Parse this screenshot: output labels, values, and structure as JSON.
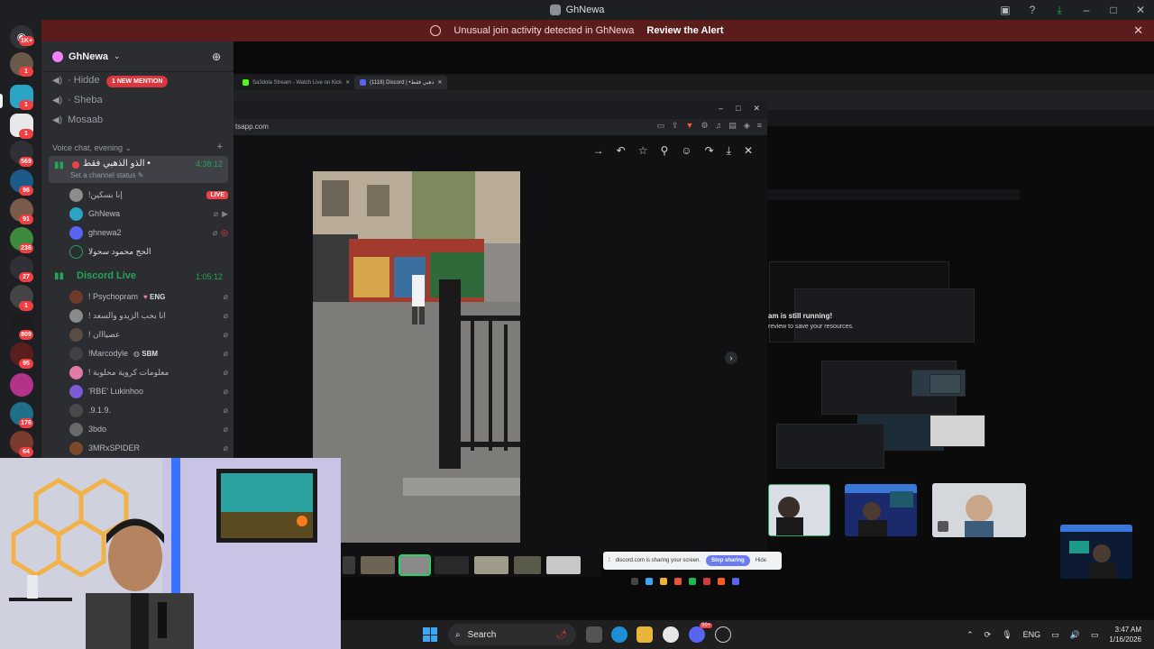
{
  "window": {
    "title": "GhNewa"
  },
  "alert": {
    "message": "Unusual join activity detected in GhNewa",
    "action": "Review the Alert"
  },
  "rail": {
    "badges": [
      "1K+",
      "1",
      "1",
      "1",
      "569",
      "96",
      "91",
      "236",
      "27",
      "1",
      "809",
      "95",
      "176",
      "64"
    ]
  },
  "guild": {
    "name": "GhNewa"
  },
  "channels": {
    "text": [
      "Hidde",
      "Sheba",
      "Mosaab"
    ],
    "mention_badge": "1 NEW MENTION",
    "category": "Voice chat, evening"
  },
  "voice1": {
    "name": "الذو الذهبي فقط •",
    "time": "4:38:12",
    "status": "Set a channel status",
    "members": [
      {
        "name": "!إنا بسكين",
        "badge": "LIVE"
      },
      {
        "name": "GhNewa"
      },
      {
        "name": "ghnewa2"
      },
      {
        "name": "الحج محمود سحولا"
      }
    ]
  },
  "voice2": {
    "name": "Discord Live",
    "time": "1:05:12",
    "members": [
      {
        "name": "! Psychopram",
        "tag": "ENG"
      },
      {
        "name": "! انا بحب الزيدو والسعد"
      },
      {
        "name": "! عصيااان"
      },
      {
        "name": "!Marcodyle",
        "tag": "SBM"
      },
      {
        "name": "! معلومات كروية محلوبة"
      },
      {
        "name": "'RBE' Lukinhoo"
      },
      {
        "name": ".9.1.9."
      },
      {
        "name": "3bdo"
      },
      {
        "name": "3MRxSPIDER"
      }
    ]
  },
  "inner_browser": {
    "tabs": [
      "Sa3dola Stream - Watch Live on Kick",
      "(1118) Discord | •ذهبي فقط"
    ],
    "url": "tsapp.com"
  },
  "viewer": {
    "share_text": "discord.com is sharing your screen.",
    "stop_label": "Stop sharing",
    "hide_label": "Hide"
  },
  "nested": {
    "line1": "am is still running!",
    "line2": "review to save your resources."
  },
  "taskbar": {
    "search_placeholder": "Search",
    "lang": "ENG",
    "time": "3:47 AM",
    "date": "1/16/2026",
    "discord_badge": "99+",
    "inner_time": "3:47 AM"
  }
}
